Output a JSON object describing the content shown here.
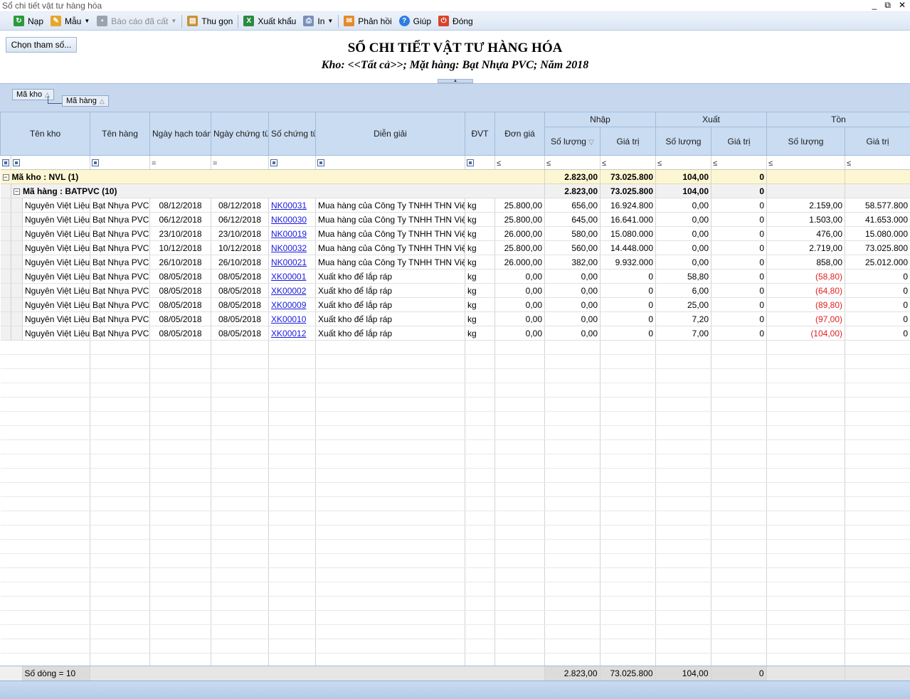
{
  "window": {
    "title": "Sổ chi tiết vật tư hàng hóa",
    "buttons": [
      "_",
      "⧉",
      "✕"
    ]
  },
  "toolbar": {
    "nap": "Nạp",
    "mau": "Mẫu",
    "bao_cao": "Báo cáo đã cất",
    "thu_gon": "Thu gọn",
    "xuat_khau": "Xuất khẩu",
    "in": "In",
    "phan_hoi": "Phản hồi",
    "giup": "Giúp",
    "dong": "Đóng"
  },
  "header": {
    "choose_button": "Chọn tham số...",
    "title": "SỔ CHI TIẾT VẬT TƯ HÀNG HÓA",
    "subtitle": "Kho: <<Tất cả>>; Mặt hàng: Bạt Nhựa PVC; Năm 2018"
  },
  "group_panel": {
    "chip1": "Mã kho",
    "chip2": "Mã hàng"
  },
  "columns": {
    "ten_kho": "Tên kho",
    "ten_hang": "Tên hàng",
    "ngay_hach_toan": "Ngày hạch toán",
    "ngay_chung_tu": "Ngày chứng từ",
    "so_chung_tu": "Số chứng từ",
    "dien_giai": "Diễn giải",
    "dvt": "ĐVT",
    "don_gia": "Đơn giá",
    "nhap": "Nhập",
    "xuat": "Xuất",
    "ton": "Tồn",
    "so_luong": "Số lượng",
    "gia_tri": "Giá trị"
  },
  "filter_ops": {
    "eq": "=",
    "le": "≤"
  },
  "group1": {
    "label": "Mã kho : NVL (1)",
    "nhap_sl": "2.823,00",
    "nhap_gt": "73.025.800",
    "xuat_sl": "104,00",
    "xuat_gt": "0"
  },
  "group2": {
    "label": "Mã hàng : BATPVC (10)",
    "nhap_sl": "2.823,00",
    "nhap_gt": "73.025.800",
    "xuat_sl": "104,00",
    "xuat_gt": "0"
  },
  "rows": [
    [
      "Nguyên Việt Liệu",
      "Bạt Nhựa PVC",
      "08/12/2018",
      "08/12/2018",
      "NK00031",
      "Mua hàng của Công Ty TNHH THN Việt",
      "kg",
      "25.800,00",
      "656,00",
      "16.924.800",
      "0,00",
      "0",
      "2.159,00",
      "58.577.800"
    ],
    [
      "Nguyên Việt Liệu",
      "Bạt Nhựa PVC",
      "06/12/2018",
      "06/12/2018",
      "NK00030",
      "Mua hàng của Công Ty TNHH THN Việt",
      "kg",
      "25.800,00",
      "645,00",
      "16.641.000",
      "0,00",
      "0",
      "1.503,00",
      "41.653.000"
    ],
    [
      "Nguyên Việt Liệu",
      "Bạt Nhựa PVC",
      "23/10/2018",
      "23/10/2018",
      "NK00019",
      "Mua hàng của Công Ty TNHH THN Việt",
      "kg",
      "26.000,00",
      "580,00",
      "15.080.000",
      "0,00",
      "0",
      "476,00",
      "15.080.000"
    ],
    [
      "Nguyên Việt Liệu",
      "Bạt Nhựa PVC",
      "10/12/2018",
      "10/12/2018",
      "NK00032",
      "Mua hàng của Công Ty TNHH THN Việt",
      "kg",
      "25.800,00",
      "560,00",
      "14.448.000",
      "0,00",
      "0",
      "2.719,00",
      "73.025.800"
    ],
    [
      "Nguyên Việt Liệu",
      "Bạt Nhựa PVC",
      "26/10/2018",
      "26/10/2018",
      "NK00021",
      "Mua hàng của Công Ty TNHH THN Việt",
      "kg",
      "26.000,00",
      "382,00",
      "9.932.000",
      "0,00",
      "0",
      "858,00",
      "25.012.000"
    ],
    [
      "Nguyên Việt Liệu",
      "Bạt Nhựa PVC",
      "08/05/2018",
      "08/05/2018",
      "XK00001",
      "Xuất kho để lắp ráp",
      "kg",
      "0,00",
      "0,00",
      "0",
      "58,80",
      "0",
      "(58,80)",
      "0"
    ],
    [
      "Nguyên Việt Liệu",
      "Bạt Nhựa PVC",
      "08/05/2018",
      "08/05/2018",
      "XK00002",
      "Xuất kho để lắp ráp",
      "kg",
      "0,00",
      "0,00",
      "0",
      "6,00",
      "0",
      "(64,80)",
      "0"
    ],
    [
      "Nguyên Việt Liệu",
      "Bạt Nhựa PVC",
      "08/05/2018",
      "08/05/2018",
      "XK00009",
      "Xuất kho để lắp ráp",
      "kg",
      "0,00",
      "0,00",
      "0",
      "25,00",
      "0",
      "(89,80)",
      "0"
    ],
    [
      "Nguyên Việt Liệu",
      "Bạt Nhựa PVC",
      "08/05/2018",
      "08/05/2018",
      "XK00010",
      "Xuất kho để lắp ráp",
      "kg",
      "0,00",
      "0,00",
      "0",
      "7,20",
      "0",
      "(97,00)",
      "0"
    ],
    [
      "Nguyên Việt Liệu",
      "Bạt Nhựa PVC",
      "08/05/2018",
      "08/05/2018",
      "XK00012",
      "Xuất kho để lắp ráp",
      "kg",
      "0,00",
      "0,00",
      "0",
      "7,00",
      "0",
      "(104,00)",
      "0"
    ]
  ],
  "footer": {
    "count": "Số dòng = 10",
    "nhap_sl": "2.823,00",
    "nhap_gt": "73.025.800",
    "xuat_sl": "104,00",
    "xuat_gt": "0"
  }
}
